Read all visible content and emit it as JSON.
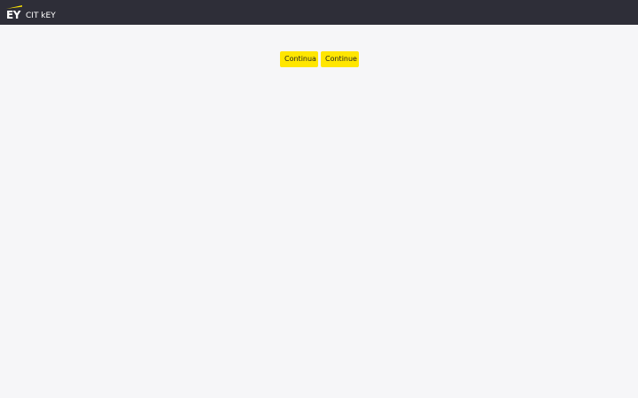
{
  "header": {
    "logo_text": "EY",
    "app_name": "CIT kEY"
  },
  "colors": {
    "header_bg": "#2e2e38",
    "accent": "#ffe600",
    "page_bg": "#f6f6f8"
  },
  "buttons": {
    "continue_it": "Continua",
    "continue_en": "Continue"
  }
}
